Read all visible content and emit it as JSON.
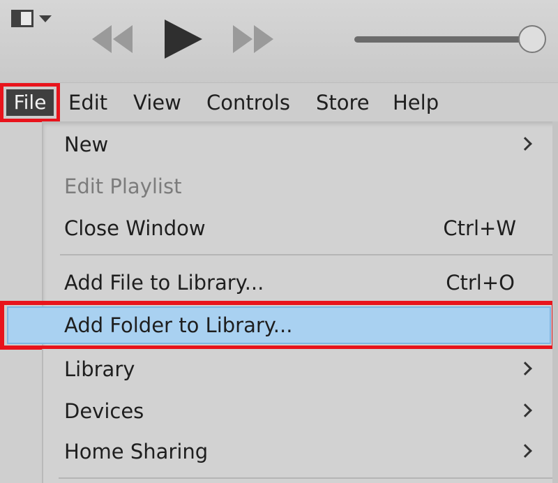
{
  "toolbar": {
    "sidebar_toggle_icon": "sidebar-toggle-icon",
    "prev_icon": "rewind-icon",
    "play_icon": "play-icon",
    "next_icon": "fast-forward-icon",
    "volume_level": 0.97
  },
  "menubar": {
    "file": "File",
    "edit": "Edit",
    "view": "View",
    "controls": "Controls",
    "store": "Store",
    "help": "Help"
  },
  "file_menu": {
    "new": "New",
    "edit_playlist": "Edit Playlist",
    "close_window": "Close Window",
    "close_window_shortcut": "Ctrl+W",
    "add_file": "Add File to Library...",
    "add_file_shortcut": "Ctrl+O",
    "add_folder": "Add Folder to Library...",
    "library": "Library",
    "devices": "Devices",
    "home_sharing": "Home Sharing"
  },
  "colors": {
    "highlight_border": "#e8141c",
    "selected_item": "#a9d1f1",
    "menu_background": "#d2d2d2"
  }
}
